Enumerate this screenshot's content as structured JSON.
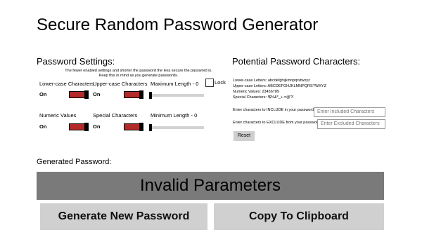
{
  "window": {
    "title": "Secure Random Password Generator"
  },
  "settings": {
    "heading": "Password Settings:",
    "note_line1": "The fewer enabled settings and shorter the password the less secure the password is.",
    "note_line2": "Keep this in mind as you generate passwords.",
    "lowercase": {
      "label": "Lower-case Characters",
      "state": "On"
    },
    "uppercase": {
      "label": "Upper-case Characters",
      "state": "On"
    },
    "numeric": {
      "label": "Numeric Values",
      "state": "On"
    },
    "special": {
      "label": "Special Characters",
      "state": "On"
    },
    "max_length": {
      "label": "Maximum Length - 0",
      "value": 0
    },
    "min_length": {
      "label": "Minimum Length - 0",
      "value": 0
    },
    "lock": {
      "label": "Lock",
      "checked": false
    }
  },
  "potential": {
    "heading": "Potential Password Characters:",
    "lowercase_line": "Lower-case Letters: abcdefghijkmnpqrstwxyz",
    "uppercase_line": "Upper-case Letters: ABCDEFGHJKLMNPQRSTWXYZ",
    "numeric_line": "Numeric Values: 23456789",
    "special_line": "Special Characters: !$%&*_+-=@?/",
    "include_label": "Enter characters to INCLUDE in your password:",
    "include_placeholder": "Enter Included Characters",
    "exclude_label": "Enter characters to EXCLUDE from your password:",
    "exclude_placeholder": "Enter Excluded Characters",
    "reset_label": "Reset"
  },
  "generated": {
    "heading": "Generated Password:",
    "value": "Invalid Parameters",
    "generate_label": "Generate New Password",
    "copy_label": "Copy To Clipboard"
  },
  "colors": {
    "toggle_on": "#b22a2a",
    "banner_bg": "#7a7a7a",
    "button_bg": "#d0d0d0"
  }
}
